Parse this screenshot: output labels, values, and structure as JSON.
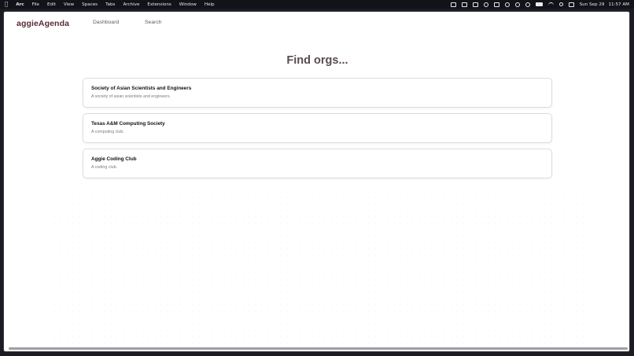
{
  "menubar": {
    "app_name": "Arc",
    "menus": [
      "File",
      "Edit",
      "View",
      "Spaces",
      "Tabs",
      "Archive",
      "Extensions",
      "Window",
      "Help"
    ],
    "date": "Sun Sep 29",
    "time": "11:57 AM"
  },
  "navbar": {
    "brand": "aggieAgenda",
    "links": [
      "Dashboard",
      "Search"
    ]
  },
  "main": {
    "title": "Find orgs...",
    "orgs": [
      {
        "name": "Society of Asian Scientists and Engineers",
        "description": "A society of asian scientists and engineers."
      },
      {
        "name": "Texas A&M Computing Society",
        "description": "A computing club."
      },
      {
        "name": "Aggie Coding Club",
        "description": "A coding club."
      }
    ]
  },
  "colors": {
    "brand": "#5b2a35",
    "title": "#5a4a50",
    "card_border": "#dcdde2"
  }
}
